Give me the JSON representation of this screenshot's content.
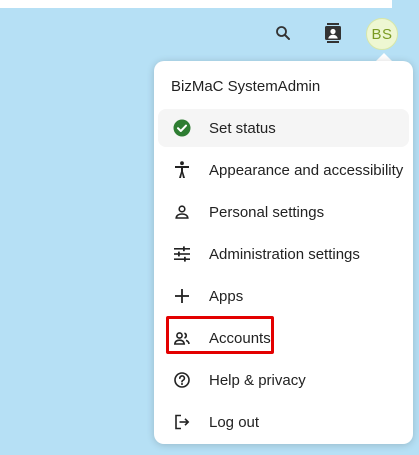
{
  "header": {
    "search_icon": "search-icon",
    "contacts_icon": "contacts-icon",
    "avatar_initials": "BS"
  },
  "menu": {
    "user_name": "BizMaC SystemAdmin",
    "items": [
      {
        "label": "Set status",
        "icon": "check-circle-icon"
      },
      {
        "label": "Appearance and accessibility",
        "icon": "accessibility-icon"
      },
      {
        "label": "Personal settings",
        "icon": "person-icon"
      },
      {
        "label": "Administration settings",
        "icon": "sliders-icon"
      },
      {
        "label": "Apps",
        "icon": "plus-icon"
      },
      {
        "label": "Accounts",
        "icon": "accounts-icon"
      },
      {
        "label": "Help & privacy",
        "icon": "help-icon"
      },
      {
        "label": "Log out",
        "icon": "logout-icon"
      }
    ]
  },
  "colors": {
    "background": "#b6e0f5",
    "status_green": "#2e7d32",
    "highlight_red": "#e30000",
    "avatar_text": "#7a9a22"
  }
}
